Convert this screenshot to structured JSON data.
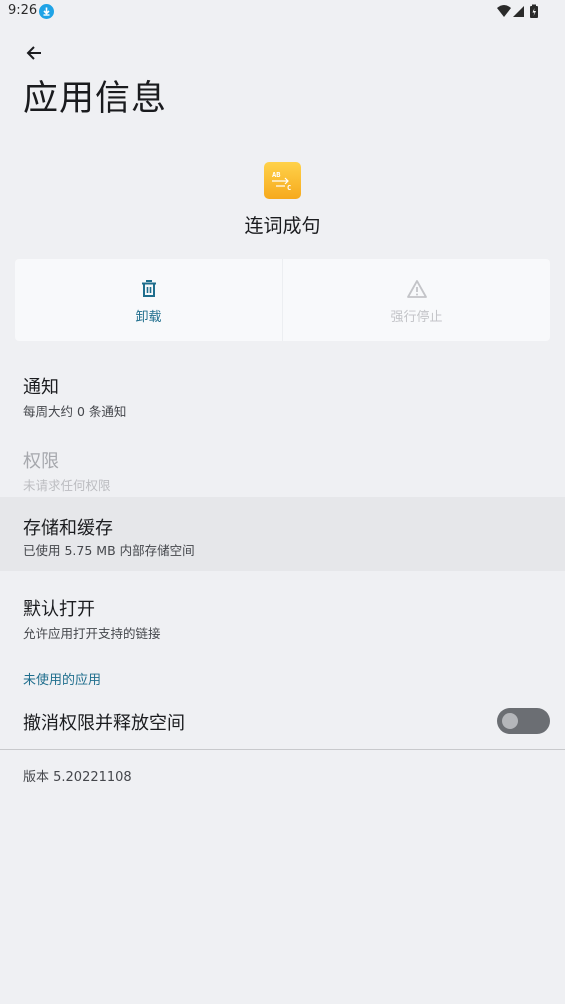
{
  "status_bar": {
    "time": "9:26",
    "download_icon": "download-icon",
    "wifi_icon": "wifi-icon",
    "signal_icon": "signal-icon",
    "battery_icon": "battery-charging-icon"
  },
  "header": {
    "back_icon": "arrow-back-icon",
    "title": "应用信息"
  },
  "app": {
    "name": "连词成句",
    "icon": "app-icon",
    "icon_colors": [
      "#ffd24a",
      "#f6a91d"
    ]
  },
  "actions": {
    "uninstall": {
      "label": "卸载",
      "icon": "trash-icon",
      "color": "#1f6e8d"
    },
    "force_stop": {
      "label": "强行停止",
      "icon": "warning-icon",
      "color": "#c3c4c8"
    }
  },
  "settings": {
    "notifications": {
      "title": "通知",
      "subtitle": "每周大约 0 条通知"
    },
    "permissions": {
      "title": "权限",
      "subtitle": "未请求任何权限"
    },
    "storage": {
      "title": "存储和缓存",
      "subtitle": "已使用 5.75 MB 内部存储空间"
    },
    "open_by_default": {
      "title": "默认打开",
      "subtitle": "允许应用打开支持的链接"
    }
  },
  "unused_apps": {
    "section_label": "未使用的应用",
    "remove_permissions": {
      "title": "撤消权限并释放空间",
      "enabled": false
    }
  },
  "version": "版本 5.20221108",
  "colors": {
    "background": "#eff0f3",
    "accent": "#1f6e8d",
    "card": "#f8f9fb"
  }
}
